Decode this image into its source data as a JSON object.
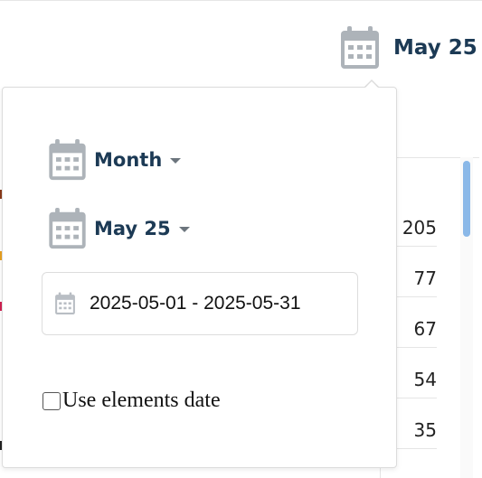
{
  "header": {
    "selected_period_label": "May 25",
    "calendar_icon": "calendar-icon"
  },
  "popover": {
    "granularity_dropdown": {
      "label": "Month",
      "icon": "calendar-icon"
    },
    "period_dropdown": {
      "label": "May 25",
      "icon": "calendar-icon"
    },
    "date_range_field": {
      "value": "2025-05-01 - 2025-05-31",
      "icon": "calendar-icon"
    },
    "use_elements_date": {
      "label": "Use elements date",
      "checked": false
    }
  },
  "background_table": {
    "values": [
      "205",
      "77",
      "67",
      "54",
      "35"
    ]
  },
  "colors": {
    "heading_text": "#1c3a55",
    "icon_gray": "#adb3b9",
    "scrollbar_thumb": "#8ab8e8",
    "border": "#dcdcdc"
  }
}
